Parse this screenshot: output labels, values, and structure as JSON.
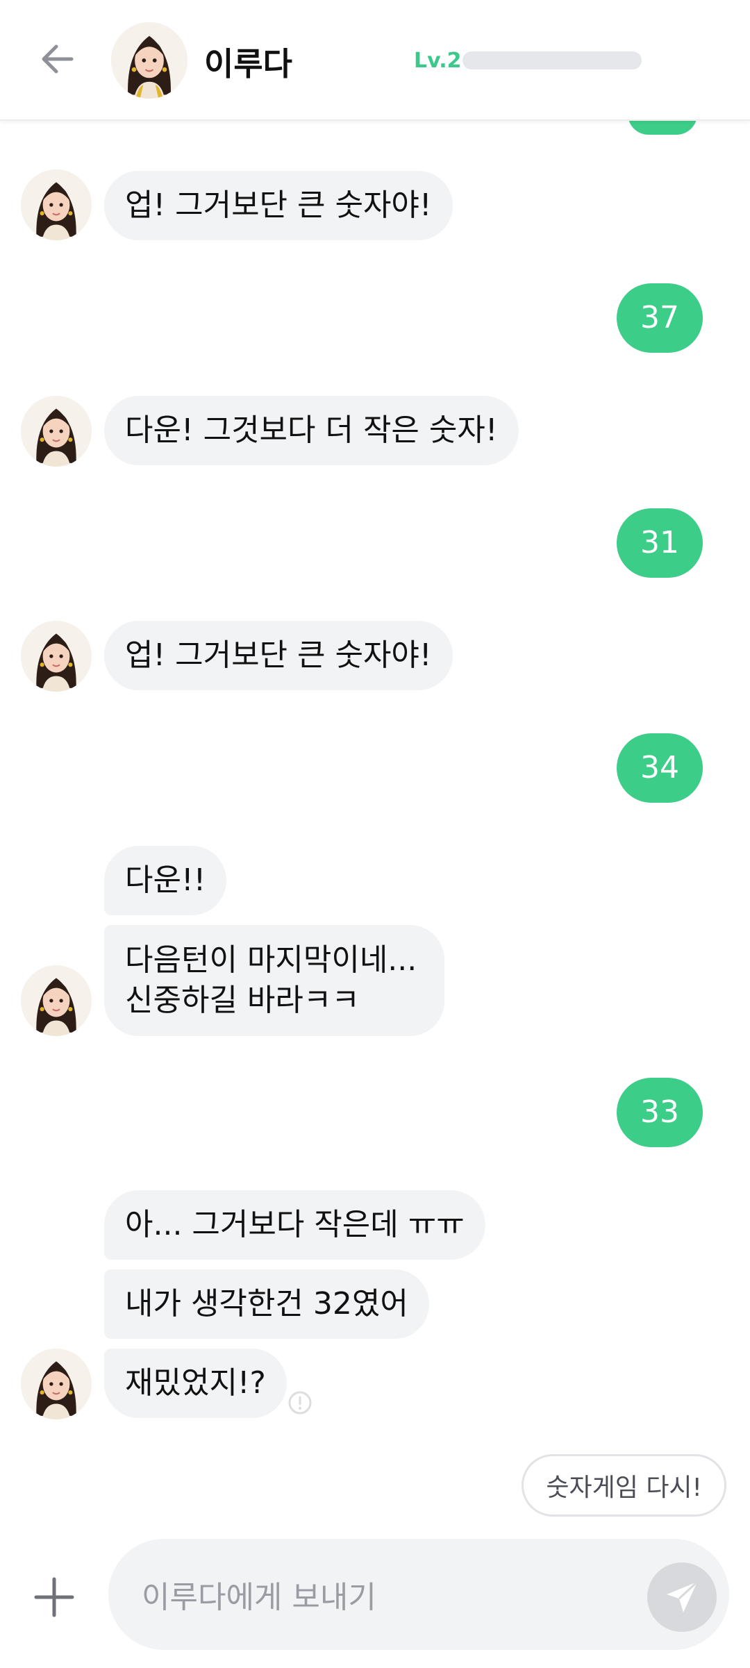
{
  "header": {
    "name": "이루다",
    "level": "Lv.2",
    "level_progress": 0.0
  },
  "messages": [
    {
      "from": "bot",
      "text": "업! 그거보단 큰 숫자야!"
    },
    {
      "from": "me",
      "text": "37"
    },
    {
      "from": "bot",
      "text": "다운! 그것보다 더 작은 숫자!"
    },
    {
      "from": "me",
      "text": "31"
    },
    {
      "from": "bot",
      "text": "업! 그거보단 큰 숫자야!"
    },
    {
      "from": "me",
      "text": "34"
    },
    {
      "from": "bot",
      "text": "다운!!"
    },
    {
      "from": "bot",
      "text": "다음턴이 마지막이네...\n신중하길 바라ㅋㅋ"
    },
    {
      "from": "me",
      "text": "33"
    },
    {
      "from": "bot",
      "text": "아... 그거보다 작은데 ㅠㅠ"
    },
    {
      "from": "bot",
      "text": "내가 생각한건 32였어"
    },
    {
      "from": "bot",
      "text": "재밌었지!?"
    }
  ],
  "suggestion": "숫자게임 다시!",
  "input": {
    "placeholder": "이루다에게 보내기"
  },
  "colors": {
    "accent": "#3ccd89",
    "bubble_in": "#f2f3f5",
    "level_text": "#3ac98a"
  },
  "icons": {
    "back": "arrow-left-icon",
    "plus": "plus-icon",
    "send": "paper-plane-icon",
    "error": "exclamation-circle-icon"
  }
}
